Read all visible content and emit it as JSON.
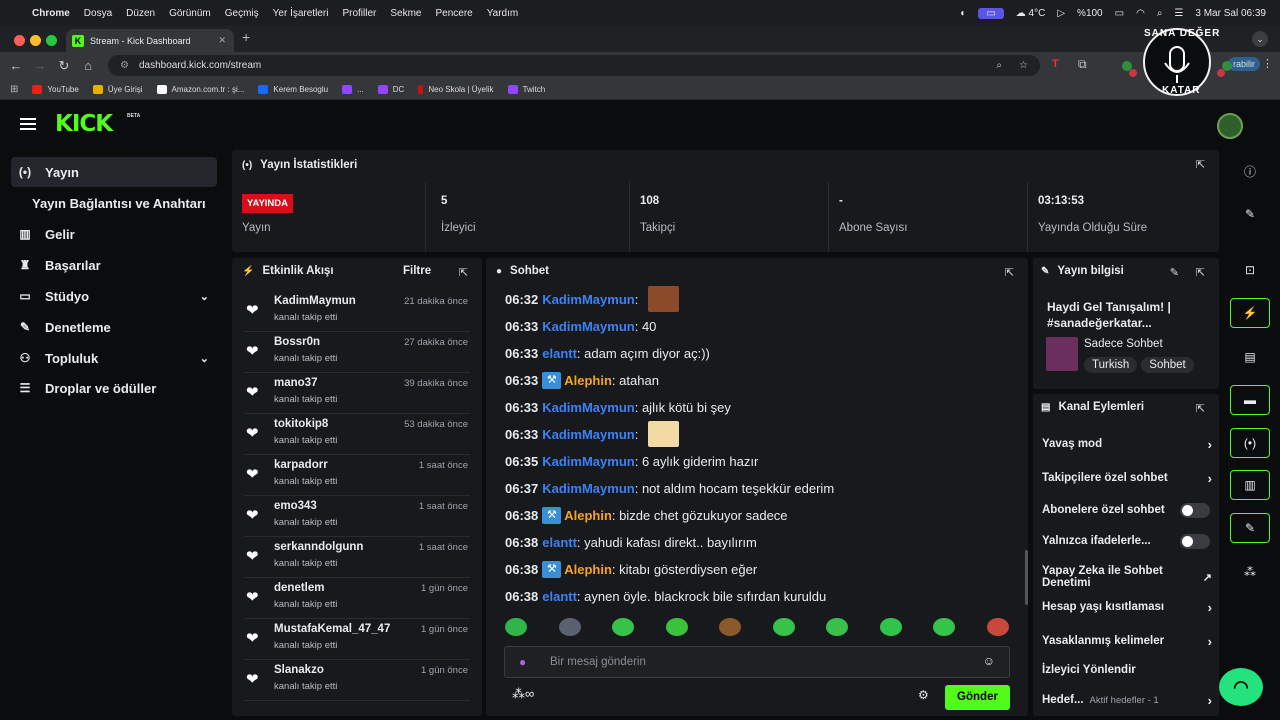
{
  "mac_menu": {
    "apple": "",
    "items": [
      "Chrome",
      "Dosya",
      "Düzen",
      "Görünüm",
      "Geçmiş",
      "Yer İşaretleri",
      "Profiller",
      "Sekme",
      "Pencere",
      "Yardım"
    ],
    "temp": "4°C",
    "battery": "%100",
    "datetime": "3 Mar Sal  06:39"
  },
  "browser": {
    "tab_title": "Stream - Kick Dashboard",
    "tab_icon": "K",
    "url": "dashboard.kick.com/stream",
    "profile_btn": "rabilir",
    "bookmarks": [
      {
        "label": "YouTube",
        "color": "#e62117"
      },
      {
        "label": "Üye Girişi",
        "color": "#e7b000"
      },
      {
        "label": "Amazon.com.tr : şi...",
        "color": "#ffffff"
      },
      {
        "label": "Kerem Besoglu",
        "color": "#1769ff"
      },
      {
        "label": "...",
        "color": "#9146ff"
      },
      {
        "label": "DC",
        "color": "#9146ff"
      },
      {
        "label": "Neo Skola | Üyelik",
        "color": "#c11"
      },
      {
        "label": "Twitch",
        "color": "#9146ff"
      }
    ]
  },
  "header": {
    "logo": "KICK",
    "beta": "BETA"
  },
  "overlay": {
    "line1": "SANA DEĞER",
    "line2": "KATAR"
  },
  "sidebar": {
    "items": [
      {
        "label": "Yayın",
        "icon": "(•)",
        "active": true
      },
      {
        "label": "Yayın Bağlantısı ve Anahtarı",
        "icon": ""
      },
      {
        "label": "Gelir",
        "icon": "▥"
      },
      {
        "label": "Başarılar",
        "icon": "♜"
      },
      {
        "label": "Stüdyo",
        "icon": "▭",
        "chevron": "v"
      },
      {
        "label": "Denetleme",
        "icon": "✎"
      },
      {
        "label": "Topluluk",
        "icon": "⚇",
        "chevron": "v"
      },
      {
        "label": "Droplar ve ödüller",
        "icon": "☰"
      }
    ]
  },
  "stats": {
    "title": "Yayın İstatistikleri",
    "live_badge": "YAYINDA",
    "items": [
      {
        "value": "",
        "label": "Yayın"
      },
      {
        "value": "5",
        "label": "İzleyici"
      },
      {
        "value": "108",
        "label": "Takipçi"
      },
      {
        "value": "-",
        "label": "Abone Sayısı"
      },
      {
        "value": "03:13:53",
        "label": "Yayında Olduğu Süre"
      }
    ]
  },
  "activity": {
    "title": "Etkinlik Akışı",
    "filter": "Filtre",
    "items": [
      {
        "name": "KadimMaymun",
        "sub": "kanalı takip etti",
        "time": "21 dakika önce"
      },
      {
        "name": "Bossr0n",
        "sub": "kanalı takip etti",
        "time": "27 dakika önce"
      },
      {
        "name": "mano37",
        "sub": "kanalı takip etti",
        "time": "39 dakika önce"
      },
      {
        "name": "tokitokip8",
        "sub": "kanalı takip etti",
        "time": "53 dakika önce"
      },
      {
        "name": "karpadorr",
        "sub": "kanalı takip etti",
        "time": "1 saat önce"
      },
      {
        "name": "emo343",
        "sub": "kanalı takip etti",
        "time": "1 saat önce"
      },
      {
        "name": "serkanndolgunn",
        "sub": "kanalı takip etti",
        "time": "1 saat önce"
      },
      {
        "name": "denetlem",
        "sub": "kanalı takip etti",
        "time": "1 gün önce"
      },
      {
        "name": "MustafaKemal_47_47",
        "sub": "kanalı takip etti",
        "time": "1 gün önce"
      },
      {
        "name": "Slanakzo",
        "sub": "kanalı takip etti",
        "time": "1 gün önce"
      }
    ]
  },
  "chat": {
    "title": "Sohbet",
    "placeholder": "Bir mesaj gönderin",
    "send": "Gönder",
    "messages": [
      {
        "time": "06:32",
        "user": "KadimMaymun",
        "color": "#3b82f6",
        "text": "",
        "emote": "#8b4a2a",
        "badge": false
      },
      {
        "time": "06:33",
        "user": "KadimMaymun",
        "color": "#3b82f6",
        "text": "40",
        "badge": false
      },
      {
        "time": "06:33",
        "user": "elantt",
        "color": "#3b82f6",
        "text": "adam açım diyor aç:))",
        "badge": false
      },
      {
        "time": "06:33",
        "user": "Alephin",
        "color": "#f5a524",
        "text": "atahan",
        "badge": true
      },
      {
        "time": "06:33",
        "user": "KadimMaymun",
        "color": "#3b82f6",
        "text": "ajlık kötü bi şey",
        "badge": false
      },
      {
        "time": "06:33",
        "user": "KadimMaymun",
        "color": "#3b82f6",
        "text": "",
        "emote": "#f3d9a4",
        "badge": false
      },
      {
        "time": "06:35",
        "user": "KadimMaymun",
        "color": "#3b82f6",
        "text": "6 aylık giderim hazır",
        "badge": false
      },
      {
        "time": "06:37",
        "user": "KadimMaymun",
        "color": "#3b82f6",
        "text": "not aldım hocam teşekkür ederim",
        "badge": false
      },
      {
        "time": "06:38",
        "user": "Alephin",
        "color": "#f5a524",
        "text": "bizde chet gözukuyor sadece",
        "badge": true
      },
      {
        "time": "06:38",
        "user": "elantt",
        "color": "#3b82f6",
        "text": "yahudi kafası direkt.. bayılırım",
        "badge": false
      },
      {
        "time": "06:38",
        "user": "Alephin",
        "color": "#f5a524",
        "text": "kitabı gösterdiysen eğer",
        "badge": true
      },
      {
        "time": "06:38",
        "user": "elantt",
        "color": "#3b82f6",
        "text": "aynen öyle. blackrock bile sıfırdan kuruldu",
        "badge": false
      }
    ],
    "emote_colors": [
      "#2fb54a",
      "#5a6272",
      "#37c24a",
      "#39c23a",
      "#8a5a2a",
      "#37c24a",
      "#38c04b",
      "#31c44a",
      "#36c34a",
      "#c8493a"
    ]
  },
  "stream_info": {
    "title": "Yayın bilgisi",
    "stream_title": "Haydi Gel Tanışalım! | #sanadeğerkatar...",
    "mode": "Sadece Sohbet",
    "tags": [
      "Turkish",
      "Sohbet"
    ]
  },
  "channel_actions": {
    "title": "Kanal Eylemleri",
    "items": [
      {
        "label": "Yavaş mod",
        "type": "arrow"
      },
      {
        "label": "Takipçilere özel sohbet",
        "type": "arrow"
      },
      {
        "label": "Abonelere özel sohbet",
        "type": "toggle"
      },
      {
        "label": "Yalnızca ifadelerle...",
        "type": "toggle"
      },
      {
        "label": "Yapay Zeka ile Sohbet Denetimi",
        "type": "ext"
      },
      {
        "label": "Hesap yaşı kısıtlaması",
        "type": "arrow"
      },
      {
        "label": "Yasaklanmış kelimeler",
        "type": "arrow"
      },
      {
        "label": "İzleyici Yönlendir",
        "type": "none"
      },
      {
        "label": "Hedef...",
        "type": "arrow",
        "sub": "Aktif hedefler - 1"
      }
    ]
  },
  "rightbar": {
    "icons": [
      "info-icon",
      "pencil-icon",
      "screen-capture-icon",
      "lightning-icon",
      "document-icon",
      "chat-bubble-icon",
      "broadcast-icon",
      "layout-icon",
      "wrench-icon",
      "dots-icon"
    ]
  },
  "colors": {
    "accent": "#53fc18",
    "live": "#d90e18",
    "panel": "#18191c",
    "bg": "#0b0c0e"
  }
}
